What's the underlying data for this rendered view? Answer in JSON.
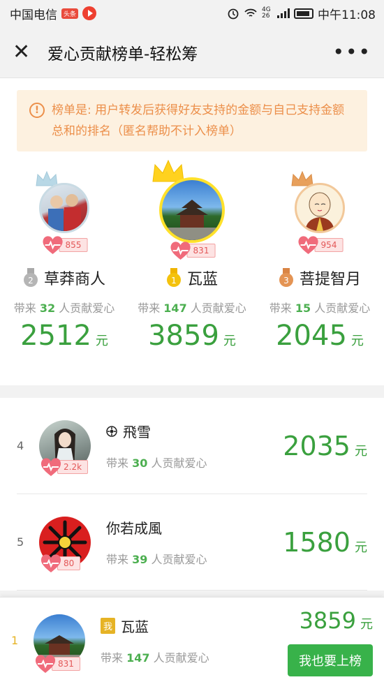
{
  "status": {
    "carrier": "中国电信",
    "badge": "头条",
    "signal": "4G 26",
    "time": "中午11:08"
  },
  "nav": {
    "title": "爱心贡献榜单-轻松筹",
    "more": "•••"
  },
  "notice": {
    "text": "榜单是: 用户转发后获得好友支持的金额与自己支持金额总和的排名（匿名帮助不计入榜单）"
  },
  "support_prefix": "带来",
  "support_suffix": "人贡献爱心",
  "unit": "元",
  "podium": [
    {
      "rank": "2",
      "name": "草莽商人",
      "hearts": "855",
      "count": "32",
      "amount": "2512"
    },
    {
      "rank": "1",
      "name": "瓦蓝",
      "hearts": "831",
      "count": "147",
      "amount": "3859"
    },
    {
      "rank": "3",
      "name": "菩提智月",
      "hearts": "954",
      "count": "15",
      "amount": "2045"
    }
  ],
  "list": [
    {
      "rank": "4",
      "name": "飛雪",
      "hearts": "2.2k",
      "count": "30",
      "amount": "2035"
    },
    {
      "rank": "5",
      "name": "你若成風",
      "hearts": "80",
      "count": "39",
      "amount": "1580"
    }
  ],
  "me": {
    "rank": "1",
    "tag": "我",
    "name": "瓦蓝",
    "hearts": "831",
    "count": "147",
    "amount": "3859",
    "button": "我也要上榜"
  },
  "colors": {
    "green": "#3aa03e",
    "notice_bg": "#fdf1e0",
    "notice_text": "#ec8f4a",
    "heart": "#f06b7b",
    "gold": "#ffd21f"
  }
}
